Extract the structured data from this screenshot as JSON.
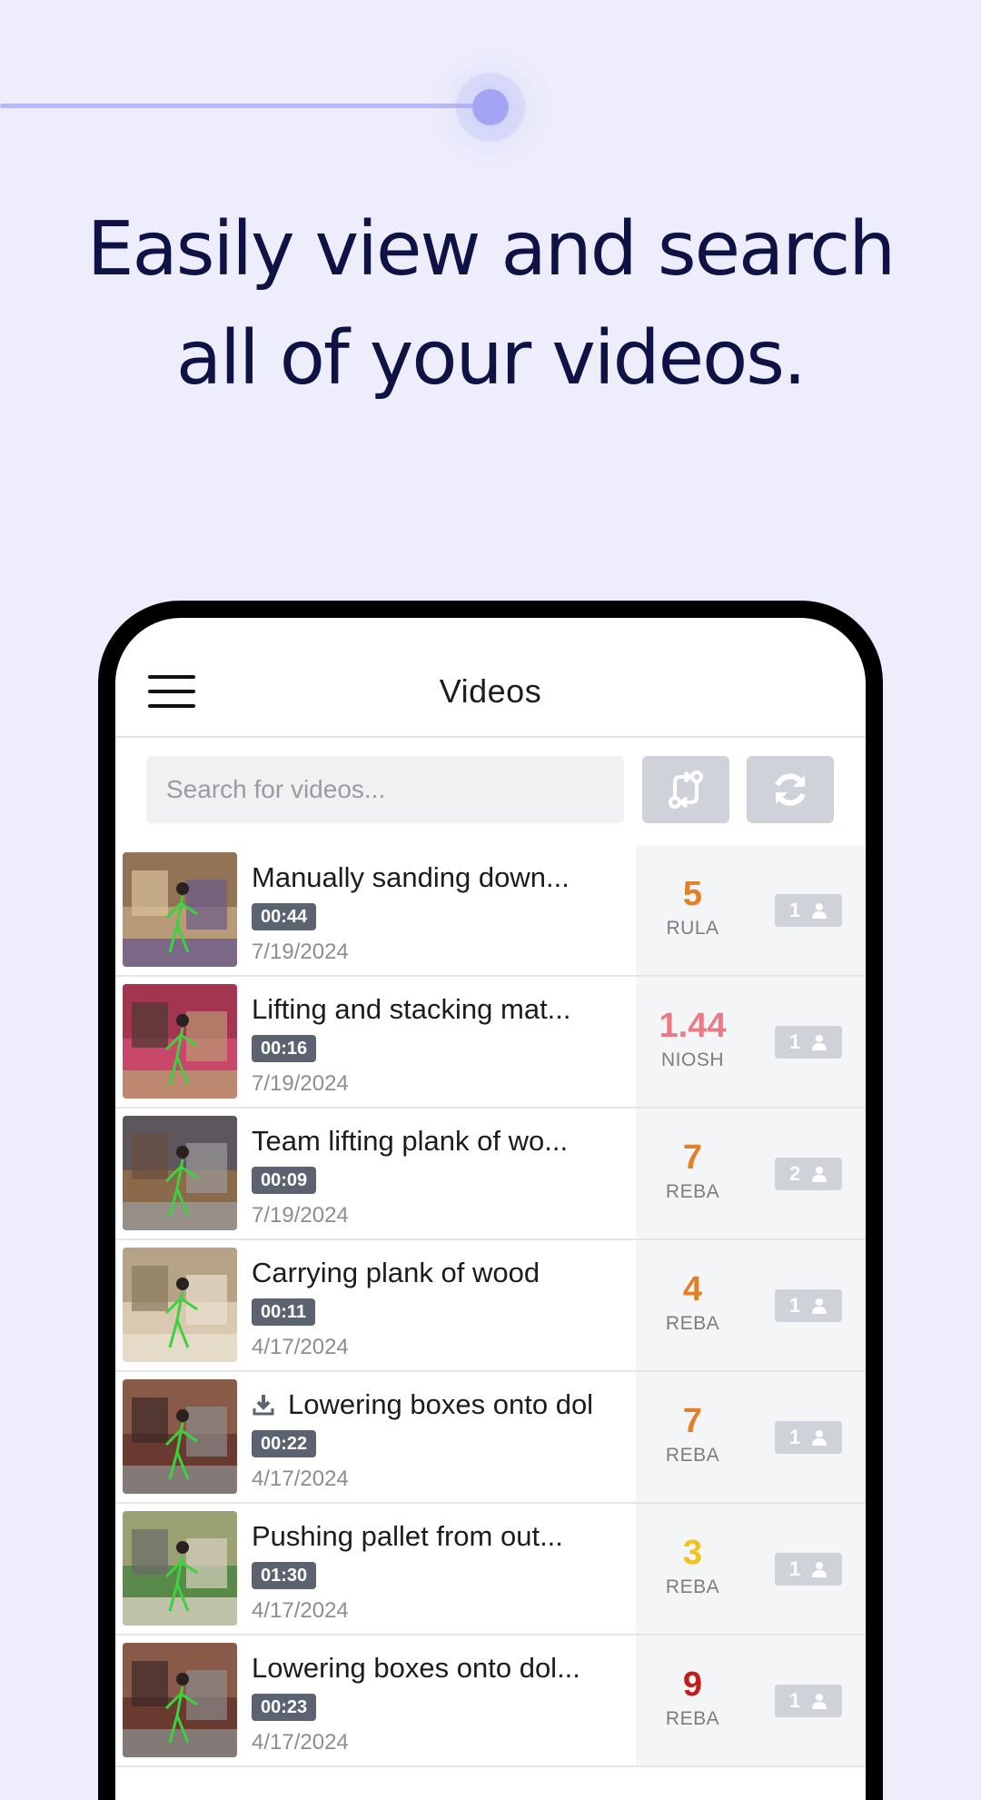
{
  "headline": {
    "line1": "Easily view and search",
    "line2": "all of your videos."
  },
  "app": {
    "title": "Videos",
    "search_placeholder": "Search for videos...",
    "sort_icon": "swap-sort-icon",
    "refresh_icon": "refresh-icon",
    "menu_icon": "hamburger-menu-icon"
  },
  "colors": {
    "background": "#ededfc",
    "accent": "#a3a5f4",
    "headline": "#0f1245",
    "score_orange": "#e0812a",
    "score_pink": "#e97a86",
    "score_yellow": "#f0c419",
    "score_red": "#c21c1c"
  },
  "videos": [
    {
      "title": "Manually sanding down...",
      "duration": "00:44",
      "date": "7/19/2024",
      "score": "5",
      "method": "RULA",
      "score_color": "#e0812a",
      "people": "1",
      "downloaded": false
    },
    {
      "title": "Lifting and stacking mat...",
      "duration": "00:16",
      "date": "7/19/2024",
      "score": "1.44",
      "method": "NIOSH",
      "score_color": "#e97a86",
      "people": "1",
      "downloaded": false
    },
    {
      "title": "Team lifting plank of wo...",
      "duration": "00:09",
      "date": "7/19/2024",
      "score": "7",
      "method": "REBA",
      "score_color": "#e0812a",
      "people": "2",
      "downloaded": false
    },
    {
      "title": "Carrying plank of wood",
      "duration": "00:11",
      "date": "4/17/2024",
      "score": "4",
      "method": "REBA",
      "score_color": "#e0812a",
      "people": "1",
      "downloaded": false
    },
    {
      "title": "Lowering boxes onto dol",
      "duration": "00:22",
      "date": "4/17/2024",
      "score": "7",
      "method": "REBA",
      "score_color": "#e0812a",
      "people": "1",
      "downloaded": true
    },
    {
      "title": "Pushing pallet from out...",
      "duration": "01:30",
      "date": "4/17/2024",
      "score": "3",
      "method": "REBA",
      "score_color": "#f0c419",
      "people": "1",
      "downloaded": false
    },
    {
      "title": "Lowering boxes onto dol...",
      "duration": "00:23",
      "date": "4/17/2024",
      "score": "9",
      "method": "REBA",
      "score_color": "#c21c1c",
      "people": "1",
      "downloaded": false
    }
  ]
}
